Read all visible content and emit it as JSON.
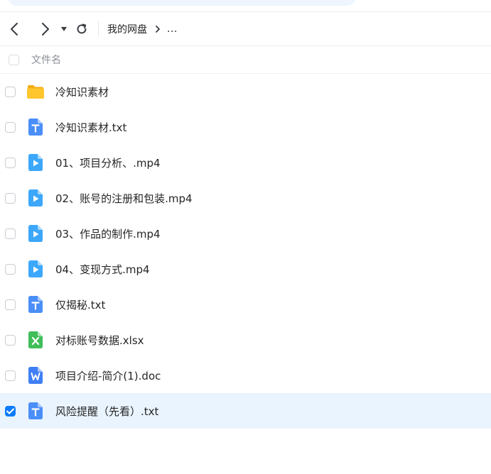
{
  "nav": {
    "back_icon": "chevron-left-icon",
    "forward_icon": "chevron-right-icon",
    "history_icon": "caret-down-icon",
    "refresh_icon": "refresh-icon"
  },
  "breadcrumb": {
    "root": "我的网盘",
    "separator_icon": "chevron-right-icon",
    "more": "..."
  },
  "list_header": {
    "column_name": "文件名"
  },
  "files": [
    {
      "name": "冷知识素材",
      "type": "folder",
      "selected": false
    },
    {
      "name": "冷知识素材.txt",
      "type": "txt",
      "selected": false
    },
    {
      "name": "01、项目分析、.mp4",
      "type": "video",
      "selected": false
    },
    {
      "name": "02、账号的注册和包装.mp4",
      "type": "video",
      "selected": false
    },
    {
      "name": "03、作品的制作.mp4",
      "type": "video",
      "selected": false
    },
    {
      "name": "04、变现方式.mp4",
      "type": "video",
      "selected": false
    },
    {
      "name": "仅揭秘.txt",
      "type": "txt",
      "selected": false
    },
    {
      "name": "对标账号数据.xlsx",
      "type": "excel",
      "selected": false
    },
    {
      "name": "项目介绍-简介(1).doc",
      "type": "word",
      "selected": false
    },
    {
      "name": "风险提醒（先看）.txt",
      "type": "txt",
      "selected": true
    }
  ],
  "colors": {
    "accent": "#0d7cfa",
    "folder": "#ffc62e",
    "txt": "#4a8ef8",
    "video": "#3ca7fb",
    "excel": "#3fbe5a",
    "word": "#3f7ff5",
    "selected_row": "#eaf4fe"
  }
}
